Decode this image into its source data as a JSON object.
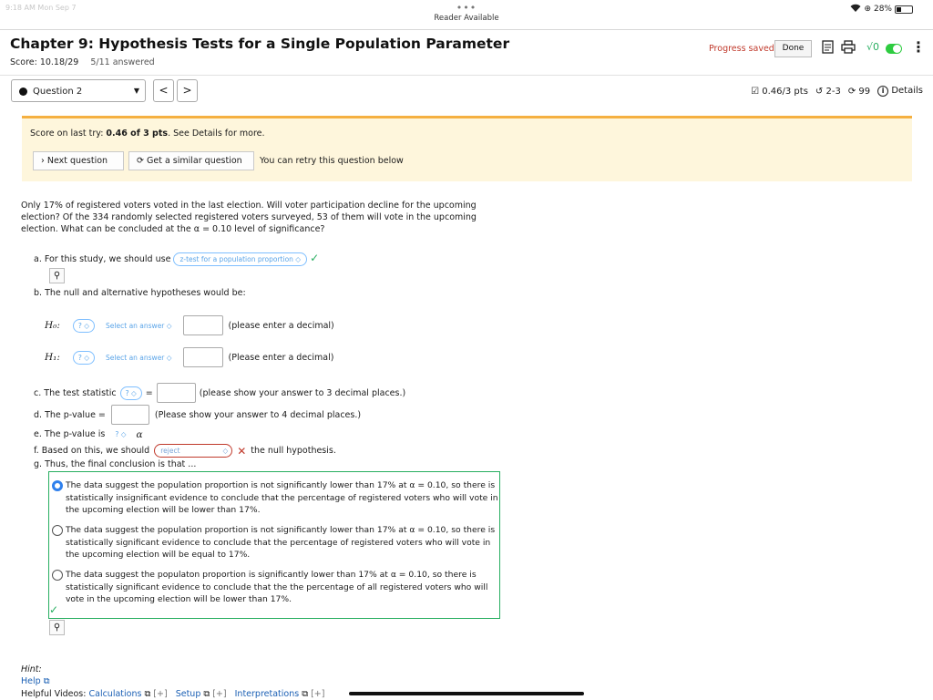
{
  "status_bar": {
    "left": "9:18 AM  Mon Sep 7",
    "dots": "•••",
    "reader": "Reader Available",
    "battery": "28%"
  },
  "header": {
    "title": "Chapter 9: Hypothesis Tests for a Single Population Parameter",
    "score_label": "Score: 10.18/29",
    "answered": "5/11 answered",
    "progress_saved": "Progress saved",
    "done_label": "Done",
    "sqrt_icon_text": "√0"
  },
  "nav": {
    "question_label": "Question 2",
    "prev": "<",
    "next": ">",
    "points": "0.46/3 pts",
    "attempts": "2-3",
    "retries": "99",
    "details": "Details"
  },
  "banner": {
    "score_prefix": "Score on last try: ",
    "score_value": "0.46 of 3 pts",
    "score_suffix": ". See Details for more.",
    "next_question": "Next question",
    "similar_question": "Get a similar question",
    "retry_text": "You can retry this question below"
  },
  "question": {
    "prompt": "Only 17% of registered voters voted in the last election. Will voter participation decline for the upcoming election? Of the 334 randomly selected registered voters surveyed, 53 of them will vote in the upcoming election. What can be concluded at the α = 0.10 level of significance?",
    "a_label": "a. For this study, we should use",
    "a_value": "z-test for a population proportion",
    "b_label": "b. The null and alternative hypotheses would be:",
    "h0_label": "H₀:",
    "h1_label": "H₁:",
    "param_placeholder": "?",
    "select_answer": "Select an answer",
    "h0_hint": "(please enter a decimal)",
    "h1_hint": "(Please enter a decimal)",
    "c_label": "c. The test statistic",
    "c_eq": "=",
    "c_hint": "(please show your answer to 3 decimal places.)",
    "d_label": "d. The p-value =",
    "d_hint": "(Please show your answer to 4 decimal places.)",
    "e_label": "e. The p-value is",
    "e_alpha": "α",
    "f_label": "f. Based on this, we should",
    "f_value": "reject",
    "f_suffix": "the null hypothesis.",
    "g_label": "g. Thus, the final conclusion is that ...",
    "choices": [
      "The data suggest the population proportion is not significantly lower than 17% at α = 0.10, so there is statistically insignificant evidence to conclude that the percentage of registered voters who will vote in the upcoming election will be lower than 17%.",
      "The data suggest the population proportion is not significantly lower than 17% at α = 0.10, so there is statistically significant evidence to conclude that the percentage of registered voters who will vote in the upcoming election will be equal to 17%.",
      "The data suggest the populaton proportion is significantly lower than 17% at α = 0.10, so there is statistically significant evidence to conclude that the the percentage of all registered voters who will vote in the upcoming election will be lower than 17%."
    ],
    "selected_choice": 0
  },
  "footer": {
    "hint": "Hint:",
    "help": "Help",
    "videos_label": "Helpful Videos:",
    "video_links": [
      "Calculations",
      "Setup",
      "Interpretations"
    ],
    "plus": "[+]"
  }
}
